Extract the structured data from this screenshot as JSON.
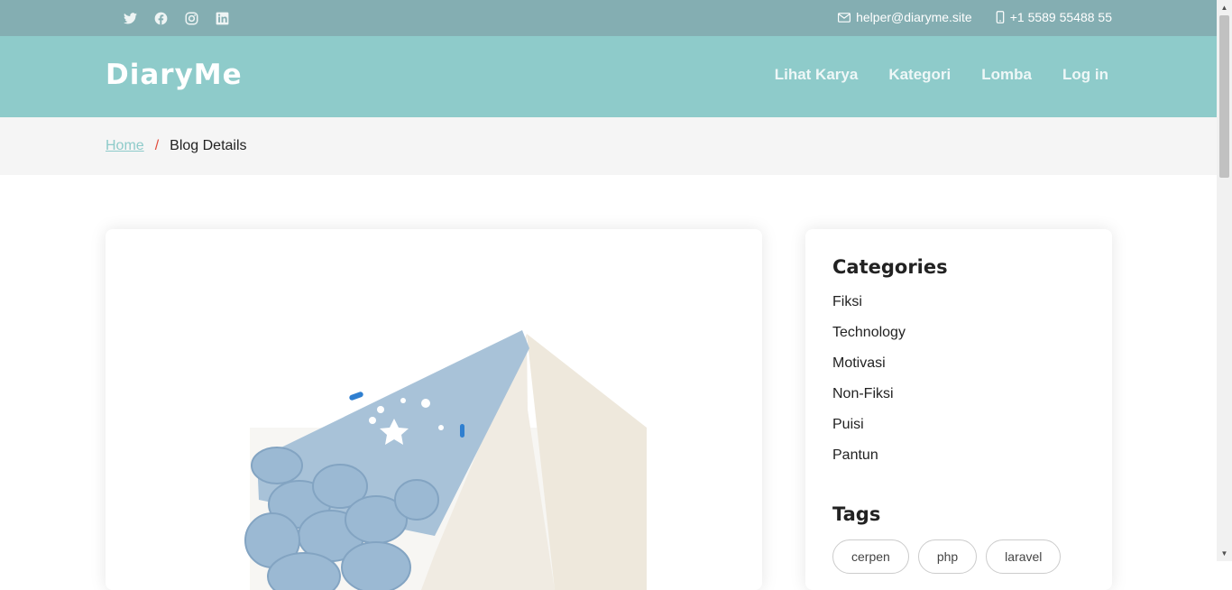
{
  "topbar": {
    "social_icons": [
      "twitter-icon",
      "facebook-icon",
      "instagram-icon",
      "linkedin-icon"
    ],
    "email": "helper@diaryme.site",
    "phone": "+1 5589 55488 55"
  },
  "header": {
    "logo": "DiaryMe",
    "nav": [
      "Lihat Karya",
      "Kategori",
      "Lomba",
      "Log in"
    ]
  },
  "breadcrumb": {
    "home": "Home",
    "separator": "/",
    "current": "Blog Details"
  },
  "sidebar": {
    "categories_title": "Categories",
    "categories": [
      "Fiksi",
      "Technology",
      "Motivasi",
      "Non-Fiksi",
      "Puisi",
      "Pantun"
    ],
    "tags_title": "Tags",
    "tags": [
      "cerpen",
      "php",
      "laravel"
    ]
  },
  "colors": {
    "topbar": "#84aeb2",
    "header": "#8ecbca",
    "breadcrumb_bg": "#f5f5f5",
    "breadcrumb_separator": "#e24a3b"
  }
}
